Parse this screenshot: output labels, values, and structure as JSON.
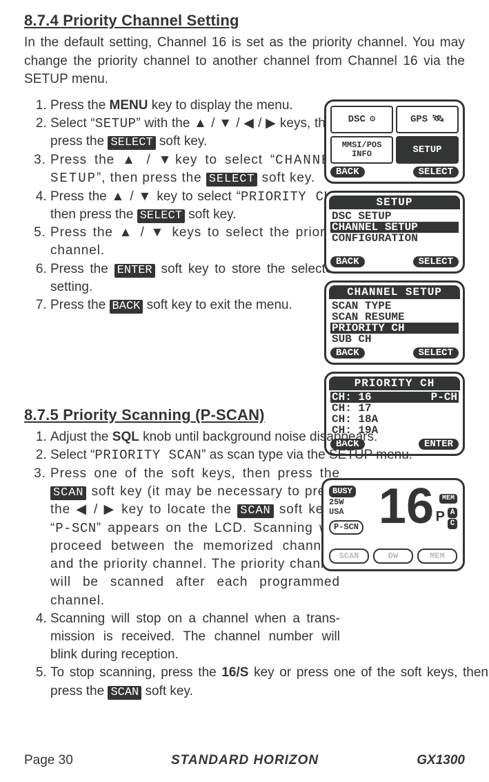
{
  "section1": {
    "heading": "8.7.4  Priority Channel Setting",
    "intro": "In the default setting, Channel 16 is set as the priority channel. You may change the priority channel to another channel from Channel 16 via the SETUP menu.",
    "steps": {
      "s1a": "Press the ",
      "s1_menu": "MENU",
      "s1b": " key to display the menu.",
      "s2a": "Select “",
      "s2_setup": "SETUP",
      "s2b": "” with the ▲ / ▼ / ◀ / ▶ keys, then press the ",
      "s2_sel": "SELECT",
      "s2c": " soft key.",
      "s3a": "Press the ▲ / ▼key to select “",
      "s3_ch": "CHANNEL SETUP",
      "s3b": "”, then press the ",
      "s3_sel": "SELECT",
      "s3c": " soft key.",
      "s4a": "Press the ▲ / ▼ key to select “",
      "s4_pr": "PRIORITY CH",
      "s4b": "”, then press the ",
      "s4_sel": "SELECT",
      "s4c": " soft key.",
      "s5": "Press the ▲ / ▼ keys to select the priority channel.",
      "s6a": "Press the ",
      "s6_enter": "ENTER",
      "s6b": " soft key to store the selected setting.",
      "s7a": "Press the ",
      "s7_back": "BACK",
      "s7b": " soft key to exit the menu."
    }
  },
  "section2": {
    "heading": "8.7.5  Priority Scanning (P-SCAN)",
    "steps": {
      "s1a": "Adjust the ",
      "s1_sql": "SQL",
      "s1b": " knob until background noise disappears.",
      "s2a": "Select “",
      "s2_ps": "PRIORITY SCAN",
      "s2b": "” as scan type via the SETUP menu.",
      "s3a": "Press one of the soft keys, then press the ",
      "s3_scan1": "SCAN",
      "s3b": " soft key (it may be necessary to press the ◀ / ▶ key to locate the ",
      "s3_scan2": "SCAN",
      "s3c": " soft key). “",
      "s3_pscn": "P-SCN",
      "s3d": "” appears on the LCD. Scanning will proceed between the memorized channels and the priority channel. The priority channel will be scanned after each programmed channel.",
      "s4": "Scanning will stop on a channel when a trans-mission is received. The channel number will blink during reception.",
      "s5a": "To stop scanning, press the ",
      "s5_16s": "16/S",
      "s5b": " key or press one of the soft keys, then press the ",
      "s5_scan": "SCAN",
      "s5c": " soft key."
    }
  },
  "lcd1": {
    "cells": {
      "dsc": "DSC",
      "gps": "GPS",
      "mmsi": "MMSI/POS INFO",
      "setup": "SETUP"
    },
    "back": "BACK",
    "select": "SELECT"
  },
  "lcd2": {
    "title": "SETUP",
    "r1": "DSC SETUP",
    "r2": "CHANNEL SETUP",
    "r3": "CONFIGURATION",
    "back": "BACK",
    "select": "SELECT"
  },
  "lcd3": {
    "title": "CHANNEL SETUP",
    "r1": "SCAN TYPE",
    "r2": "SCAN RESUME",
    "r3": "PRIORITY CH",
    "r4": "SUB CH",
    "back": "BACK",
    "select": "SELECT"
  },
  "lcd4": {
    "title": "PRIORITY CH",
    "r1a": "CH: 16",
    "r1b": "P-CH",
    "r2": "CH: 17",
    "r3": "CH: 18A",
    "r4": "CH: 19A",
    "back": "BACK",
    "enter": "ENTER"
  },
  "lcd5": {
    "busy": "BUSY",
    "w25": "25W",
    "usa": "USA",
    "pscn": "P-SCN",
    "big": "16",
    "mem": "MEM",
    "p": "P",
    "a": "A",
    "c": "C",
    "b1": "SCAN",
    "b2": "DW",
    "b3": "MEM"
  },
  "footer": {
    "page": "Page 30",
    "brand": "STANDARD HORIZON",
    "model": "GX1300"
  }
}
